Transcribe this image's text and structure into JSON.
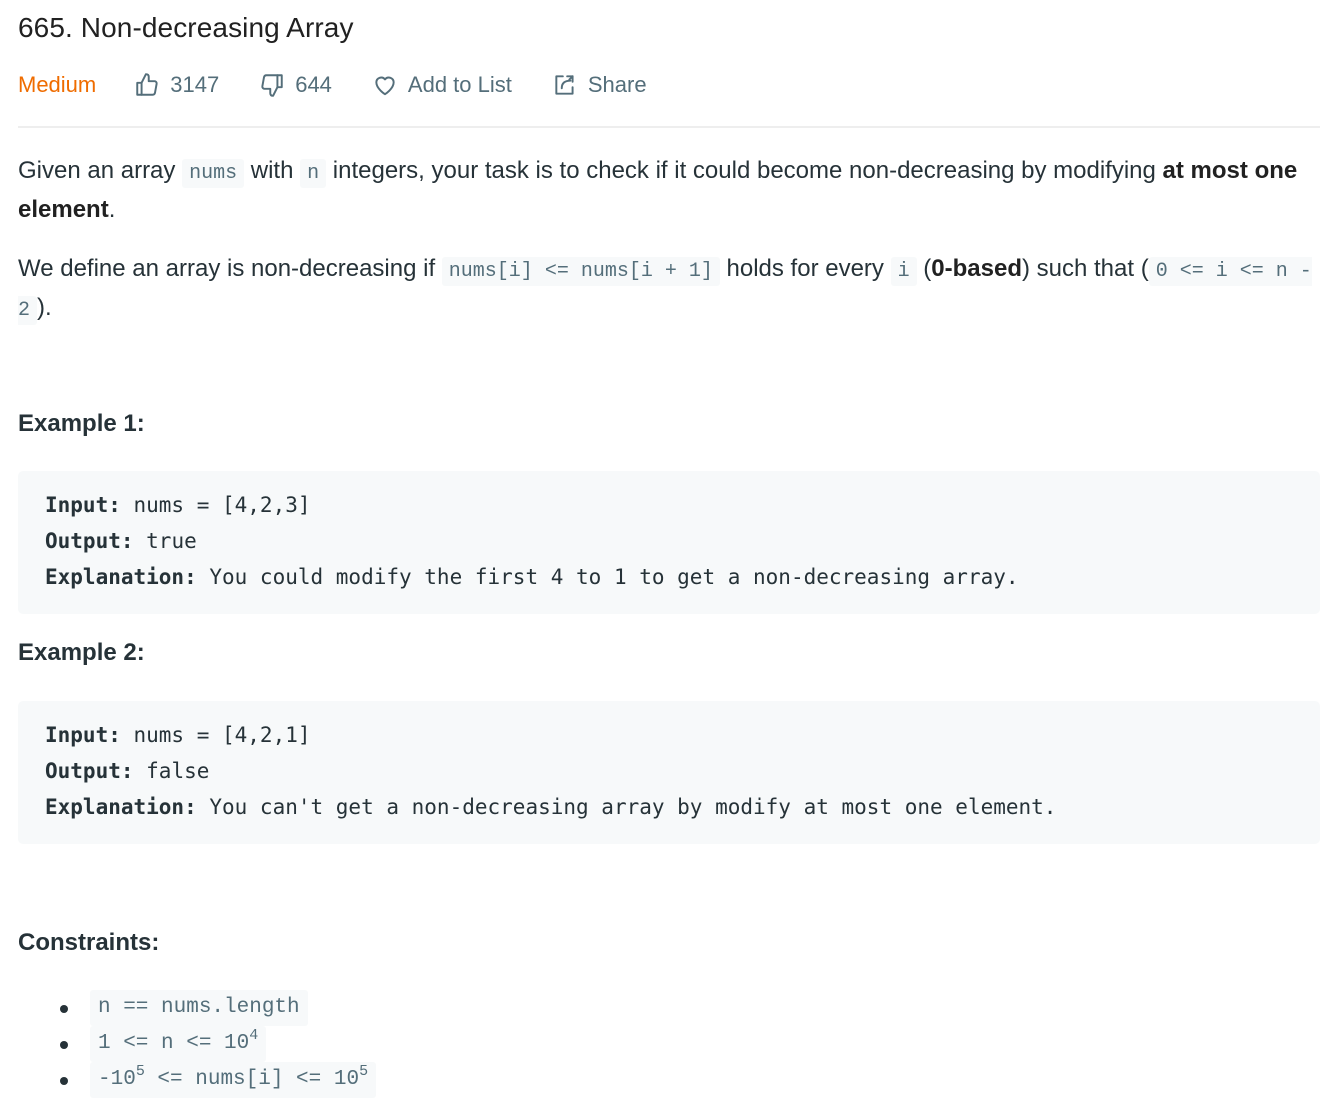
{
  "problem": {
    "title": "665. Non-decreasing Array",
    "difficulty": "Medium",
    "difficulty_color": "#ef6c00",
    "likes": "3147",
    "dislikes": "644",
    "add_to_list_label": "Add to List",
    "share_label": "Share",
    "icons": {
      "like": "thumbs-up-icon",
      "dislike": "thumbs-down-icon",
      "favorite": "heart-icon",
      "share": "share-icon"
    }
  },
  "description": {
    "p1": {
      "t1": "Given an array ",
      "c1": "nums",
      "t2": " with ",
      "c2": "n",
      "t3": " integers, your task is to check if it could become non-decreasing by modifying ",
      "b1": "at most one element",
      "t4": "."
    },
    "p2": {
      "t1": "We define an array is non-decreasing if ",
      "c1": "nums[i] <= nums[i + 1]",
      "t2": " holds for every ",
      "c2": "i",
      "t3": " (",
      "b1": "0-based",
      "t4": ") such that (",
      "c3": "0 <= i <= n - 2",
      "t5": ")."
    }
  },
  "examples": [
    {
      "title": "Example 1:",
      "input_label": "Input:",
      "input": " nums = [4,2,3]",
      "output_label": "Output:",
      "output": " true",
      "explanation_label": "Explanation:",
      "explanation": " You could modify the first 4 to 1 to get a non-decreasing array."
    },
    {
      "title": "Example 2:",
      "input_label": "Input:",
      "input": " nums = [4,2,1]",
      "output_label": "Output:",
      "output": " false",
      "explanation_label": "Explanation:",
      "explanation": " You can't get a non-decreasing array by modify at most one element."
    }
  ],
  "constraints": {
    "title": "Constraints:",
    "items": [
      {
        "text": "n == nums.length"
      },
      {
        "pre": "1 <= n <= 10",
        "sup": "4"
      },
      {
        "pre": "-10",
        "sup1": "5",
        "mid": " <= nums[i] <= 10",
        "sup2": "5"
      }
    ]
  }
}
